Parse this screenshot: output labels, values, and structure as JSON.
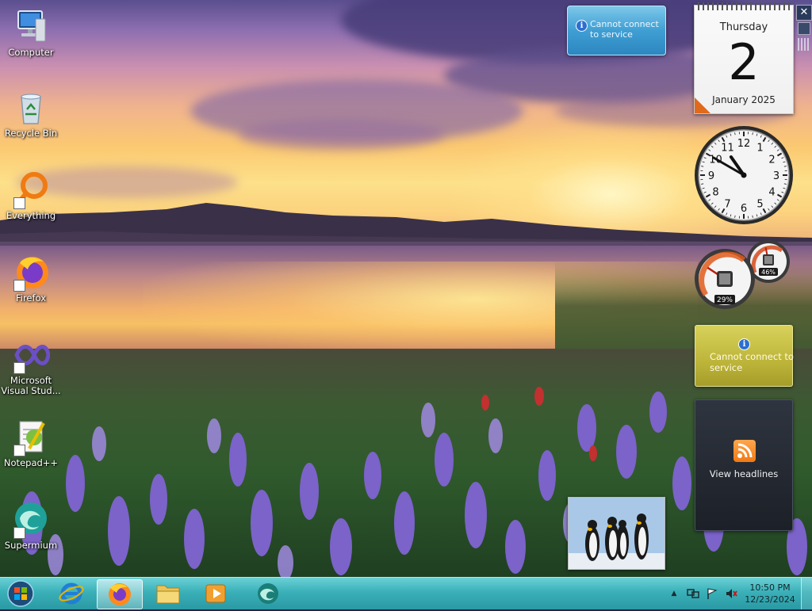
{
  "desktop": {
    "icons": [
      {
        "label": "Computer",
        "icon": "computer-icon"
      },
      {
        "label": "Recycle Bin",
        "icon": "recycle-bin-icon"
      },
      {
        "label": "Everything",
        "icon": "everything-icon"
      },
      {
        "label": "Firefox",
        "icon": "firefox-icon"
      },
      {
        "label": "Microsoft Visual Stud...",
        "icon": "visual-studio-icon"
      },
      {
        "label": "Notepad++",
        "icon": "notepad-plus-plus-icon"
      },
      {
        "label": "Supermium",
        "icon": "supermium-icon"
      }
    ]
  },
  "gadgets": {
    "weather": {
      "message": "Cannot connect to service",
      "icon": "info-icon",
      "info_glyph": "i"
    },
    "calendar": {
      "weekday": "Thursday",
      "day": "2",
      "month_year": "January 2025"
    },
    "clock": {
      "hour": 10,
      "minute": 50,
      "numerals": [
        "12",
        "1",
        "2",
        "3",
        "4",
        "5",
        "6",
        "7",
        "8",
        "9",
        "10",
        "11"
      ]
    },
    "cpu_meter": {
      "cpu_percent": 29,
      "memory_percent": 46,
      "cpu_label": "29%",
      "memory_label": "46%"
    },
    "currency": {
      "message": "Cannot connect to service",
      "icon": "info-icon",
      "info_glyph": "i"
    },
    "feed": {
      "message": "View headlines",
      "icon": "rss-icon"
    },
    "slideshow": {
      "image": "penguins-photo"
    },
    "close_glyph": "✕"
  },
  "taskbar": {
    "start_icon": "windows-start-orb",
    "pinned": [
      {
        "name": "Internet Explorer",
        "icon": "internet-explorer-icon"
      },
      {
        "name": "Firefox",
        "icon": "firefox-icon",
        "active": true
      },
      {
        "name": "Windows Explorer",
        "icon": "folder-icon"
      },
      {
        "name": "Windows Media Player",
        "icon": "media-player-icon"
      },
      {
        "name": "Supermium",
        "icon": "supermium-icon"
      }
    ],
    "tray": {
      "show_hidden_glyph": "▲",
      "time": "10:50 PM",
      "date": "12/23/2024"
    }
  },
  "colors": {
    "taskbar": "#3ab0b8",
    "weather_gadget": "#3f9fd3",
    "currency_gadget": "#bdb53a",
    "feed_gadget": "#1c2027",
    "calendar_corner": "#e06a1c"
  }
}
